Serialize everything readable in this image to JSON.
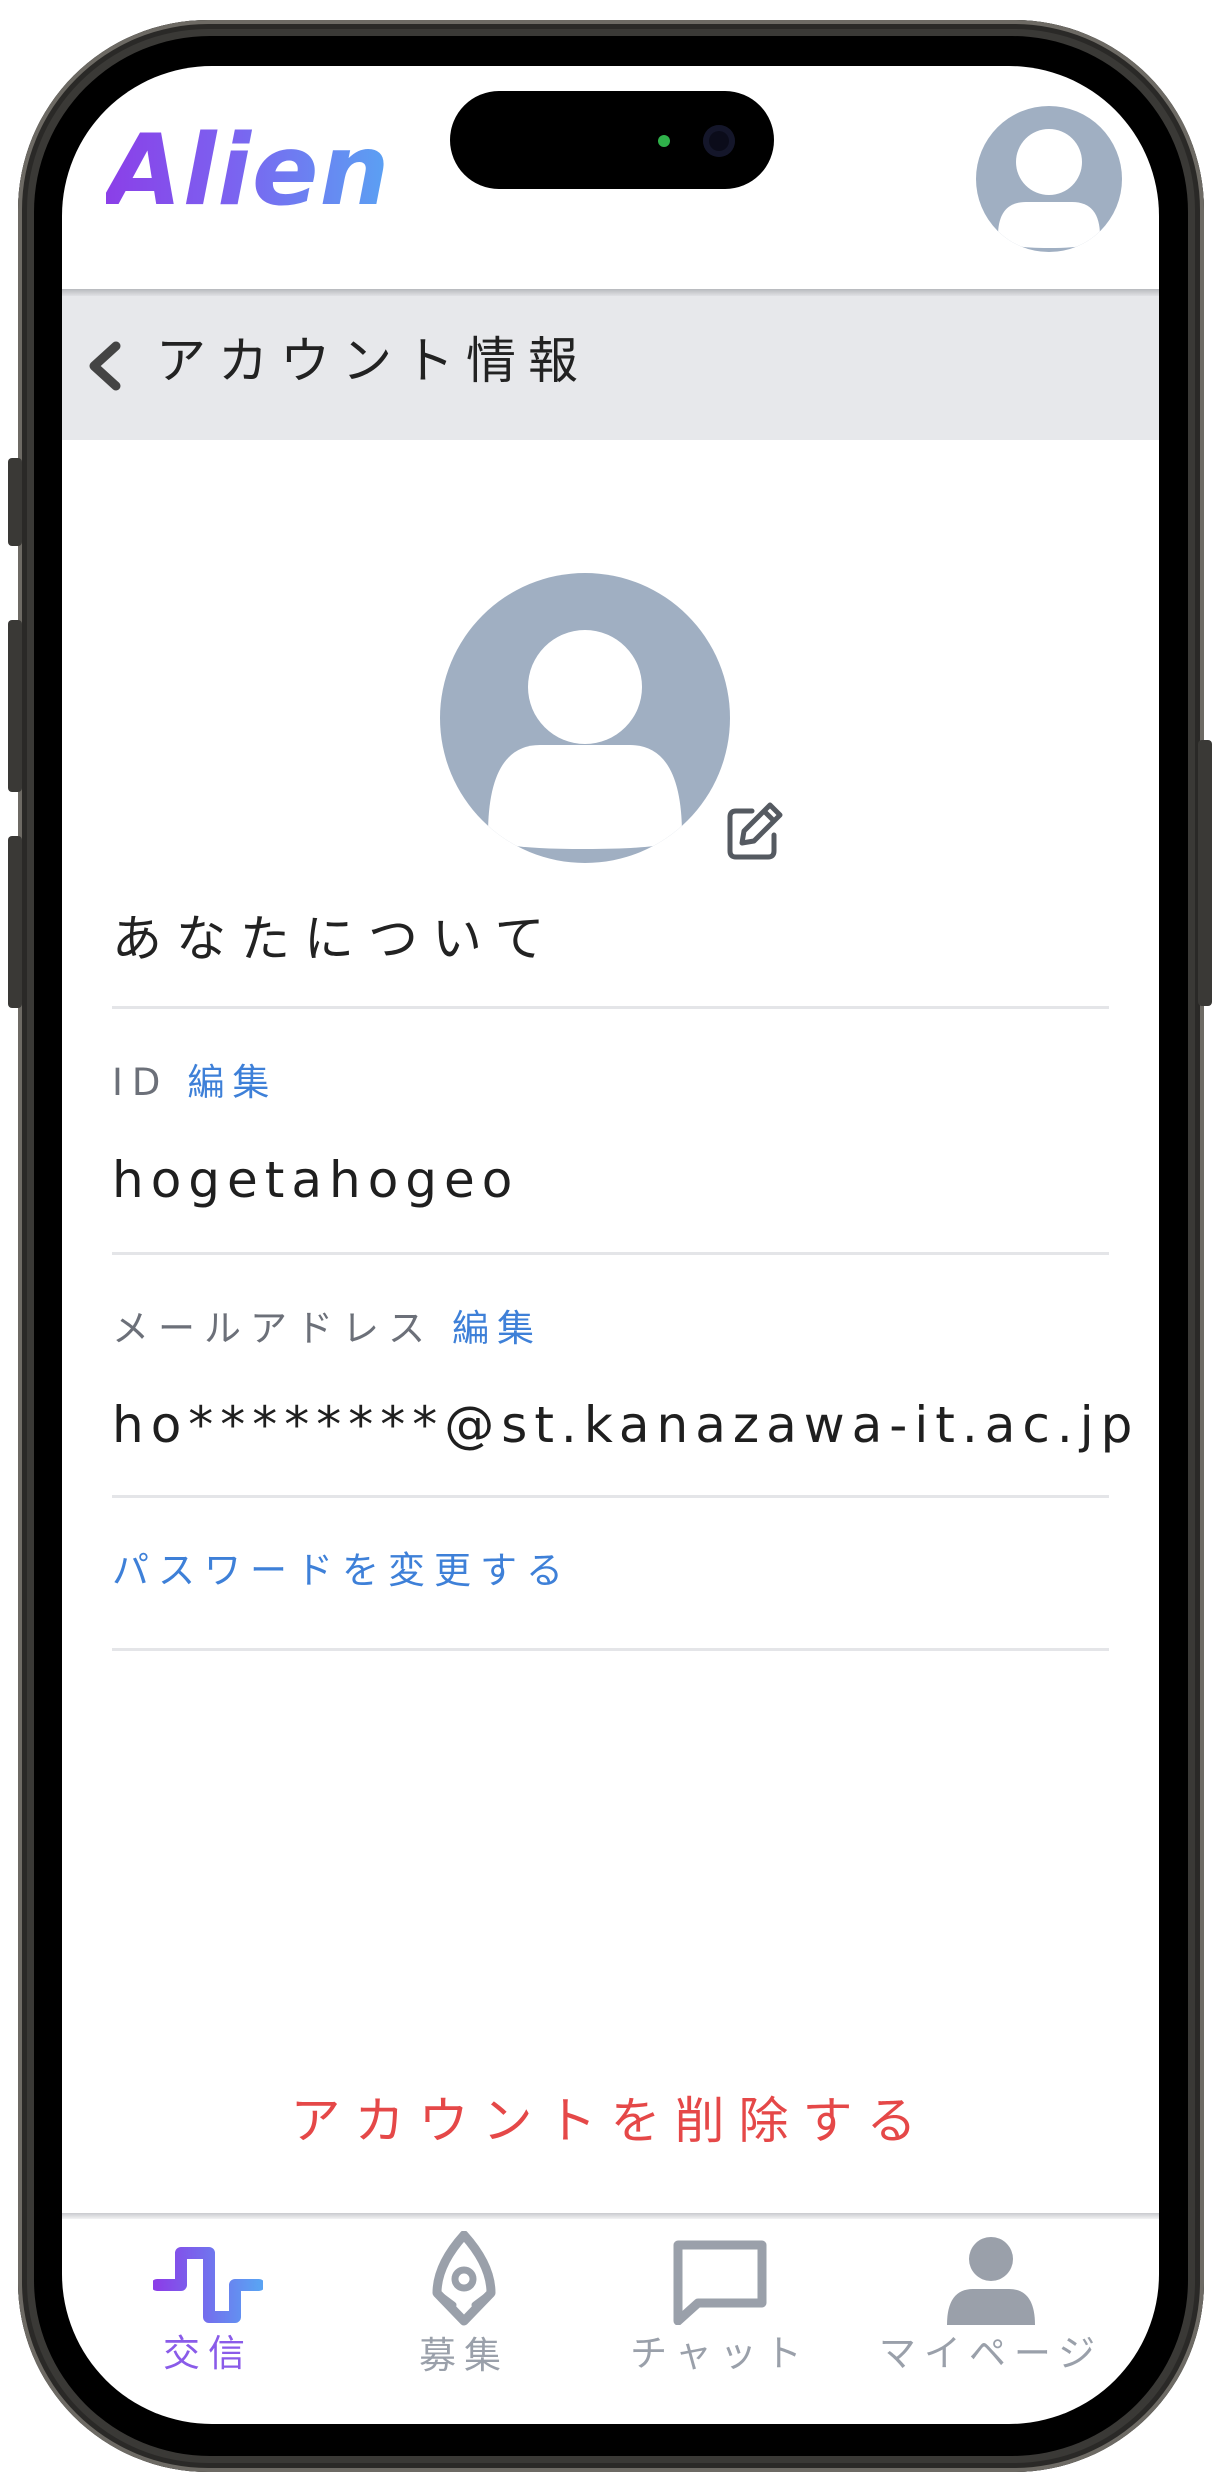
{
  "header": {
    "logo_text": "Alien"
  },
  "subheader": {
    "title": "アカウント情報"
  },
  "profile": {
    "section_title": "あなたについて"
  },
  "fields": [
    {
      "label": "ID",
      "edit_label": "編集",
      "value": "hogetahogeo"
    },
    {
      "label": "メールアドレス",
      "edit_label": "編集",
      "value": "ho********@st.kanazawa-it.ac.jp"
    }
  ],
  "change_password_label": "パスワードを変更する",
  "delete_account_label": "アカウントを削除する",
  "bottom_nav": {
    "items": [
      {
        "label": "交信",
        "icon": "pulse-icon",
        "active": true
      },
      {
        "label": "募集",
        "icon": "rocket-icon",
        "active": false
      },
      {
        "label": "チャット",
        "icon": "chat-bubble-icon",
        "active": false
      },
      {
        "label": "マイページ",
        "icon": "person-icon",
        "active": false
      }
    ]
  },
  "colors": {
    "accent_gradient": [
      "#8b3fe8",
      "#5aa2f3"
    ],
    "link": "#3e80d8",
    "danger": "#e54848",
    "avatar": "#a0afc2",
    "nav_inactive": "#9aa0aa",
    "nav_active": "#8a5be9"
  }
}
